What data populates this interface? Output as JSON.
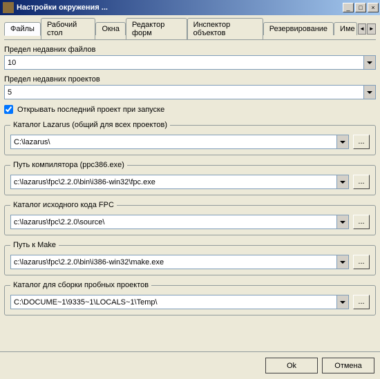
{
  "window": {
    "title": "Настройки окружения ..."
  },
  "tabs": {
    "t0": "Файлы",
    "t1": "Рабочий стол",
    "t2": "Окна",
    "t3": "Редактор форм",
    "t4": "Инспектор объектов",
    "t5": "Резервирование",
    "t6": "Име"
  },
  "recent_files": {
    "label": "Предел недавних файлов",
    "value": "10"
  },
  "recent_projects": {
    "label": "Предел недавних проектов",
    "value": "5"
  },
  "open_last": {
    "label": "Открывать последний проект при запуске",
    "checked": true
  },
  "groups": {
    "lazarus_dir": {
      "legend": "Каталог Lazarus (общий для всех проектов)",
      "value": "C:\\lazarus\\"
    },
    "compiler_path": {
      "legend": "Путь компилятора (ppc386.exe)",
      "value": "c:\\lazarus\\fpc\\2.2.0\\bin\\i386-win32\\fpc.exe"
    },
    "fpc_src": {
      "legend": "Каталог исходного кода FPC",
      "value": "c:\\lazarus\\fpc\\2.2.0\\source\\"
    },
    "make_path": {
      "legend": "Путь к Make",
      "value": "c:\\lazarus\\fpc\\2.2.0\\bin\\i386-win32\\make.exe"
    },
    "test_dir": {
      "legend": "Каталог для сборки пробных проектов",
      "value": "C:\\DOCUME~1\\9335~1\\LOCALS~1\\Temp\\"
    }
  },
  "browse_label": "...",
  "buttons": {
    "ok": "Ok",
    "cancel": "Отмена"
  }
}
